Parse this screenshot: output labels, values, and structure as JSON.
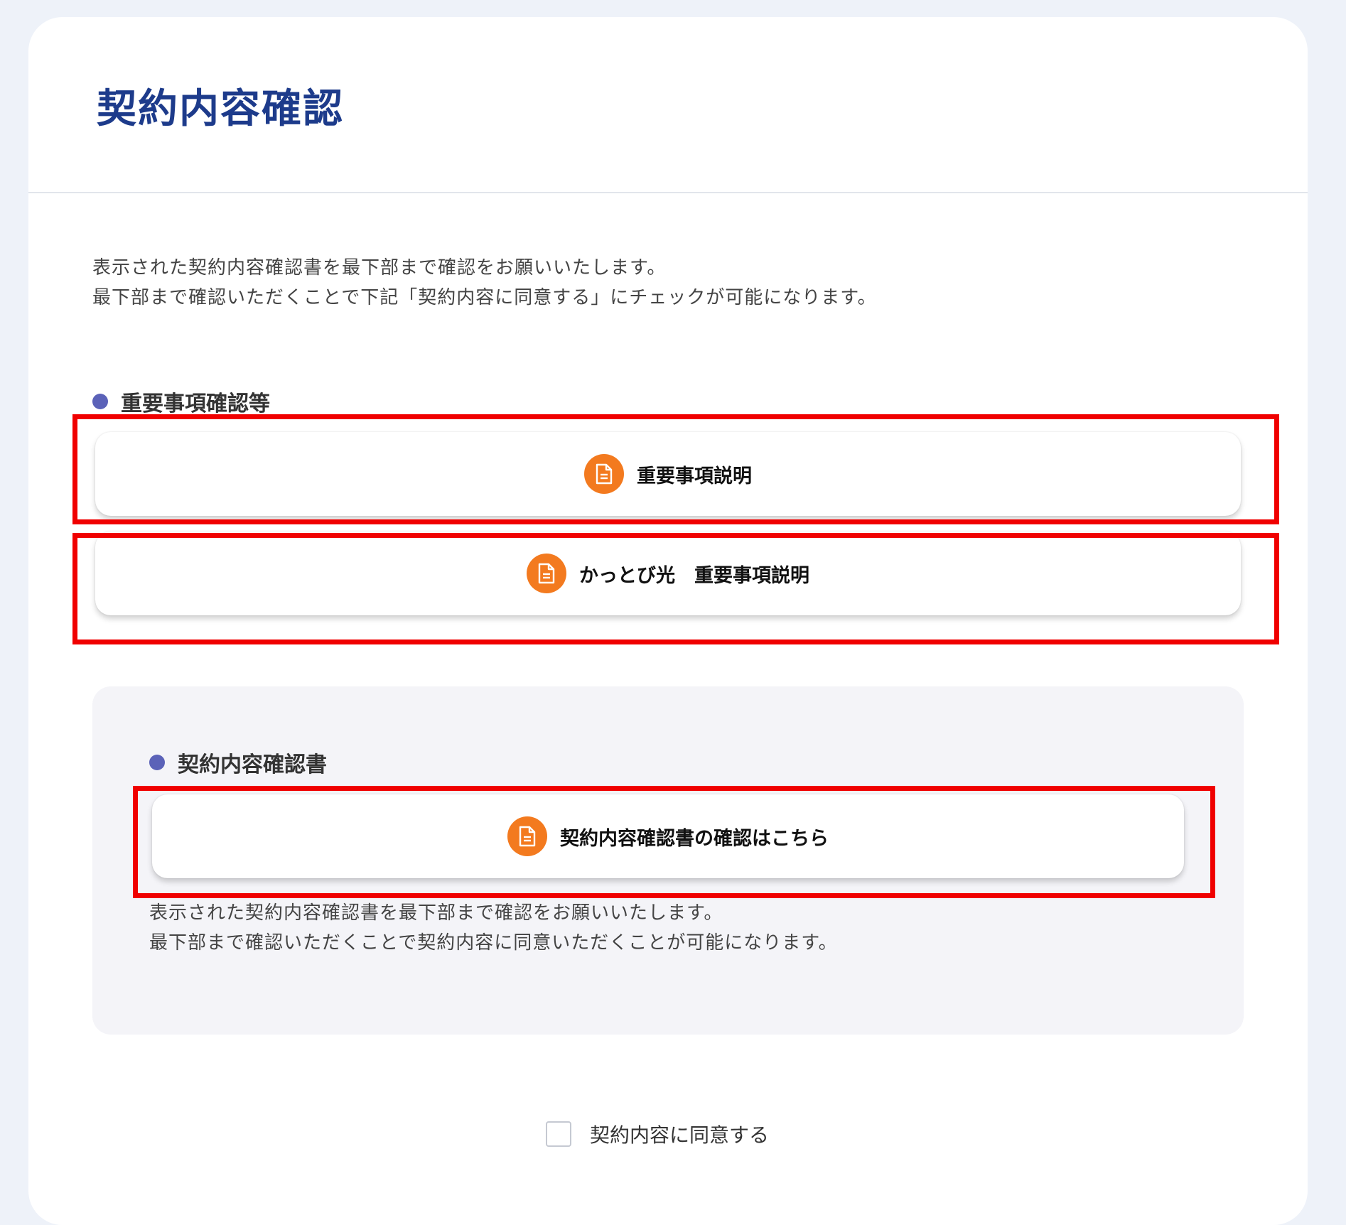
{
  "page": {
    "title": "契約内容確認"
  },
  "intro": {
    "line1": "表示された契約内容確認書を最下部まで確認をお願いいたします。",
    "line2": "最下部まで確認いただくことで下記「契約内容に同意する」にチェックが可能になります。"
  },
  "section_important": {
    "heading": "重要事項確認等",
    "buttons": [
      {
        "label": "重要事項説明",
        "icon": "document-icon"
      },
      {
        "label": "かっとび光　重要事項説明",
        "icon": "document-icon"
      }
    ]
  },
  "section_contract": {
    "heading": "契約内容確認書",
    "button": {
      "label": "契約内容確認書の確認はこちら",
      "icon": "document-icon"
    },
    "note_line1": "表示された契約内容確認書を最下部まで確認をお願いいたします。",
    "note_line2": "最下部まで確認いただくことで契約内容に同意いただくことが可能になります。"
  },
  "agreement": {
    "label": "契約内容に同意する",
    "checked": false
  },
  "colors": {
    "title": "#1d3b8b",
    "accent_orange": "#f37a1f",
    "bullet": "#5b62b8",
    "highlight_red": "#f00000",
    "background": "#eef2f9"
  }
}
